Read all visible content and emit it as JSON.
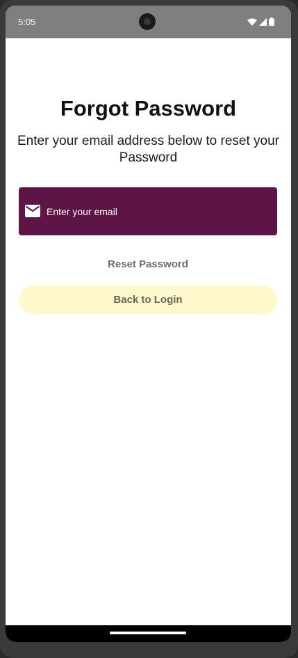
{
  "status_bar": {
    "time": "5:05",
    "icons": [
      "wifi-icon",
      "signal-icon",
      "battery-icon"
    ]
  },
  "main": {
    "title": "Forgot Password",
    "subtitle": "Enter your email address below to reset your Password",
    "email_field": {
      "placeholder": "Enter your email",
      "value": "",
      "icon": "mail-icon"
    },
    "reset_button_label": "Reset Password",
    "back_button_label": "Back to Login"
  },
  "colors": {
    "email_field_bg": "#5c1545",
    "back_button_bg": "#fff8cc",
    "status_bar_bg": "#7f7f7f"
  }
}
